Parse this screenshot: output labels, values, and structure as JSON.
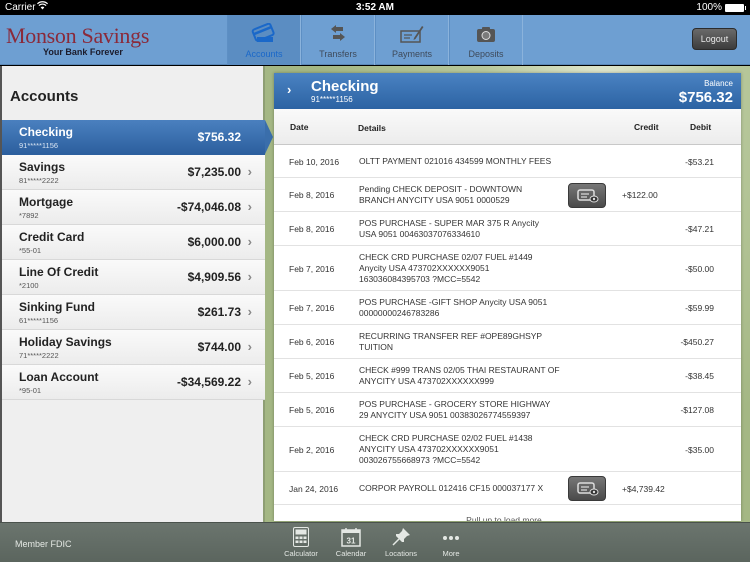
{
  "status_bar": {
    "carrier": "Carrier",
    "wifi_icon": "wifi-icon",
    "time": "3:52 AM",
    "battery_percent": "100%",
    "battery_icon": "battery-icon"
  },
  "header": {
    "bank_name": "Monson Savings",
    "tagline": "Your Bank Forever",
    "nav_tabs": [
      {
        "label": "Accounts",
        "icon": "credit-card-icon",
        "active": true
      },
      {
        "label": "Transfers",
        "icon": "transfer-arrows-icon",
        "active": false
      },
      {
        "label": "Payments",
        "icon": "check-pen-icon",
        "active": false
      },
      {
        "label": "Deposits",
        "icon": "camera-icon",
        "active": false
      }
    ],
    "logout_label": "Logout",
    "active_color": "#1a68c9"
  },
  "accounts_panel": {
    "title": "Accounts",
    "accounts": [
      {
        "name": "Checking",
        "number": "91*****1156",
        "balance": "$756.32",
        "selected": true
      },
      {
        "name": "Savings",
        "number": "81*****2222",
        "balance": "$7,235.00",
        "selected": false
      },
      {
        "name": "Mortgage",
        "number": "*7892",
        "balance": "-$74,046.08",
        "selected": false
      },
      {
        "name": "Credit Card",
        "number": "*55-01",
        "balance": "$6,000.00",
        "selected": false
      },
      {
        "name": "Line Of Credit",
        "number": "*2100",
        "balance": "$4,909.56",
        "selected": false
      },
      {
        "name": "Sinking Fund",
        "number": "61*****1156",
        "balance": "$261.73",
        "selected": false
      },
      {
        "name": "Holiday Savings",
        "number": "71*****2222",
        "balance": "$744.00",
        "selected": false
      },
      {
        "name": "Loan Account",
        "number": "*95-01",
        "balance": "-$34,569.22",
        "selected": false
      }
    ]
  },
  "detail_panel": {
    "account_name": "Checking",
    "account_number": "91*****1156",
    "balance_label": "Balance",
    "balance": "$756.32",
    "columns": {
      "date": "Date",
      "details": "Details",
      "credit": "Credit",
      "debit": "Debit"
    },
    "transactions": [
      {
        "date": "Feb 10, 2016",
        "details": [
          "OLTT PAYMENT 021016 434599 MONTHLY FEES"
        ],
        "credit": "",
        "debit": "-$53.21",
        "has_image": false
      },
      {
        "date": "Feb 8, 2016",
        "details": [
          "Pending CHECK DEPOSIT - DOWNTOWN",
          "BRANCH ANYCITY USA 9051 0000529"
        ],
        "credit": "+$122.00",
        "debit": "",
        "has_image": true
      },
      {
        "date": "Feb 8, 2016",
        "details": [
          "POS PURCHASE -  SUPER MAR 375 R Anycity",
          "USA 9051 00463037076334610"
        ],
        "credit": "",
        "debit": "-$47.21",
        "has_image": false
      },
      {
        "date": "Feb 7, 2016",
        "details": [
          "CHECK CRD PURCHASE 02/07  FUEL #1449",
          "Anycity USA 473702XXXXXX9051",
          "163036084395703 ?MCC=5542"
        ],
        "credit": "",
        "debit": "-$50.00",
        "has_image": false
      },
      {
        "date": "Feb 7, 2016",
        "details": [
          "POS PURCHASE -GIFT SHOP Anycity USA 9051",
          "00000000246783286"
        ],
        "credit": "",
        "debit": "-$59.99",
        "has_image": false
      },
      {
        "date": "Feb 6, 2016",
        "details": [
          "RECURRING TRANSFER REF #OPE89GHSYP",
          "TUITION"
        ],
        "credit": "",
        "debit": "-$450.27",
        "has_image": false
      },
      {
        "date": "Feb 5, 2016",
        "details": [
          "CHECK #999 TRANS 02/05 THAI RESTAURANT OF",
          "ANYCITY USA 473702XXXXXX999"
        ],
        "credit": "",
        "debit": "-$38.45",
        "has_image": false
      },
      {
        "date": "Feb 5, 2016",
        "details": [
          "POS PURCHASE - GROCERY STORE HIGHWAY",
          "29 ANYCITY USA 9051 00383026774559397"
        ],
        "credit": "",
        "debit": "-$127.08",
        "has_image": false
      },
      {
        "date": "Feb 2, 2016",
        "details": [
          "CHECK CRD PURCHASE 02/02 FUEL #1438",
          "ANYCITY USA 473702XXXXXX9051",
          "003026755668973 ?MCC=5542"
        ],
        "credit": "",
        "debit": "-$35.00",
        "has_image": false
      },
      {
        "date": "Jan 24, 2016",
        "details": [
          "CORPOR PAYROLL 012416 CF15 000037177 X"
        ],
        "credit": "+$4,739.42",
        "debit": "",
        "has_image": true
      }
    ],
    "view_image_icon": "view-check-image-icon",
    "pull_more": "Pull up to load more..."
  },
  "footer": {
    "fdic": "Member FDIC",
    "tools": [
      {
        "label": "Calculator",
        "icon": "calculator-icon"
      },
      {
        "label": "Calendar",
        "icon": "calendar-icon",
        "icon_text": "31"
      },
      {
        "label": "Locations",
        "icon": "pushpin-icon"
      },
      {
        "label": "More",
        "icon": "more-dots-icon"
      }
    ]
  }
}
